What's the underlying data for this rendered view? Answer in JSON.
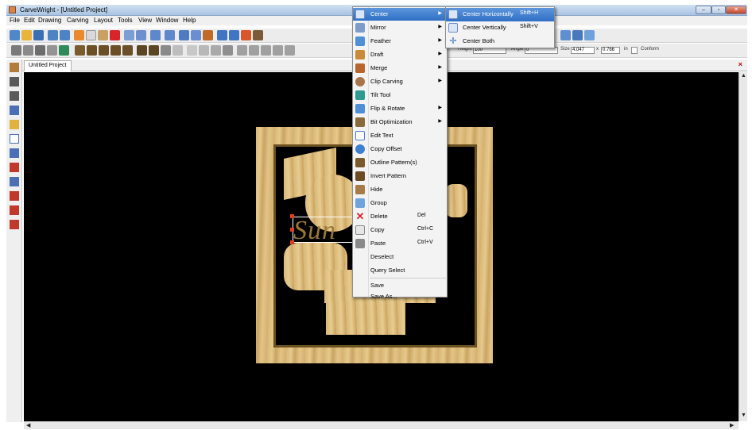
{
  "window": {
    "title": "CarveWright - [Untitled Project]"
  },
  "menubar": [
    "File",
    "Edit",
    "Drawing",
    "Carving",
    "Layout",
    "Tools",
    "View",
    "Window",
    "Help"
  ],
  "toolbar2": {
    "height_label": "Height",
    "height_value": "100",
    "angle_label": "Angle",
    "angle_value": "0",
    "size_label": "Size",
    "size_w": "4.047",
    "x_label": "x",
    "size_h": "0.766",
    "units": "in",
    "conform_label": "Conform"
  },
  "tabs": [
    "Untitled Project"
  ],
  "canvas": {
    "selected_text": "Sun"
  },
  "context_menu": [
    {
      "label": "Center",
      "icon": "center-icon",
      "submenu": true,
      "highlighted": true
    },
    {
      "label": "Mirror",
      "icon": "mirror-icon",
      "submenu": true
    },
    {
      "label": "Feather",
      "icon": "feather-icon",
      "submenu": true
    },
    {
      "label": "Draft",
      "icon": "draft-icon",
      "submenu": true
    },
    {
      "label": "Merge",
      "icon": "merge-icon",
      "submenu": true
    },
    {
      "label": "Clip Carving",
      "icon": "clip-carving-icon",
      "submenu": true
    },
    {
      "label": "Tilt Tool",
      "icon": "tilt-tool-icon"
    },
    {
      "label": "Flip & Rotate",
      "icon": "flip-rotate-icon",
      "submenu": true
    },
    {
      "label": "Bit Optimization",
      "icon": "bit-optimization-icon",
      "submenu": true
    },
    {
      "label": "Edit Text",
      "icon": "edit-text-icon"
    },
    {
      "label": "Copy Offset",
      "icon": "copy-offset-icon"
    },
    {
      "label": "Outline Pattern(s)",
      "icon": "outline-pattern-icon"
    },
    {
      "label": "Invert Pattern",
      "icon": "invert-pattern-icon"
    },
    {
      "label": "Hide",
      "icon": "hide-icon"
    },
    {
      "label": "Group",
      "icon": "group-icon"
    },
    {
      "label": "Delete",
      "icon": "delete-icon",
      "shortcut": "Del"
    },
    {
      "label": "Copy",
      "icon": "copy-icon",
      "shortcut": "Ctrl+C"
    },
    {
      "label": "Paste",
      "icon": "paste-icon",
      "shortcut": "Ctrl+V"
    },
    {
      "label": "Deselect"
    },
    {
      "label": "Query Select"
    },
    {
      "label": "Save"
    },
    {
      "label": "Save As..."
    }
  ],
  "submenu": [
    {
      "label": "Center Horizontally",
      "shortcut": "Shift+H",
      "icon": "center-horizontally-icon",
      "highlighted": true
    },
    {
      "label": "Center Vertically",
      "shortcut": "Shift+V",
      "icon": "center-vertically-icon"
    },
    {
      "label": "Center Both",
      "icon": "center-both-icon"
    }
  ],
  "colors": {
    "highlight": "#2f6fc4",
    "canvas": "#000000",
    "wood": "#d9b878"
  }
}
